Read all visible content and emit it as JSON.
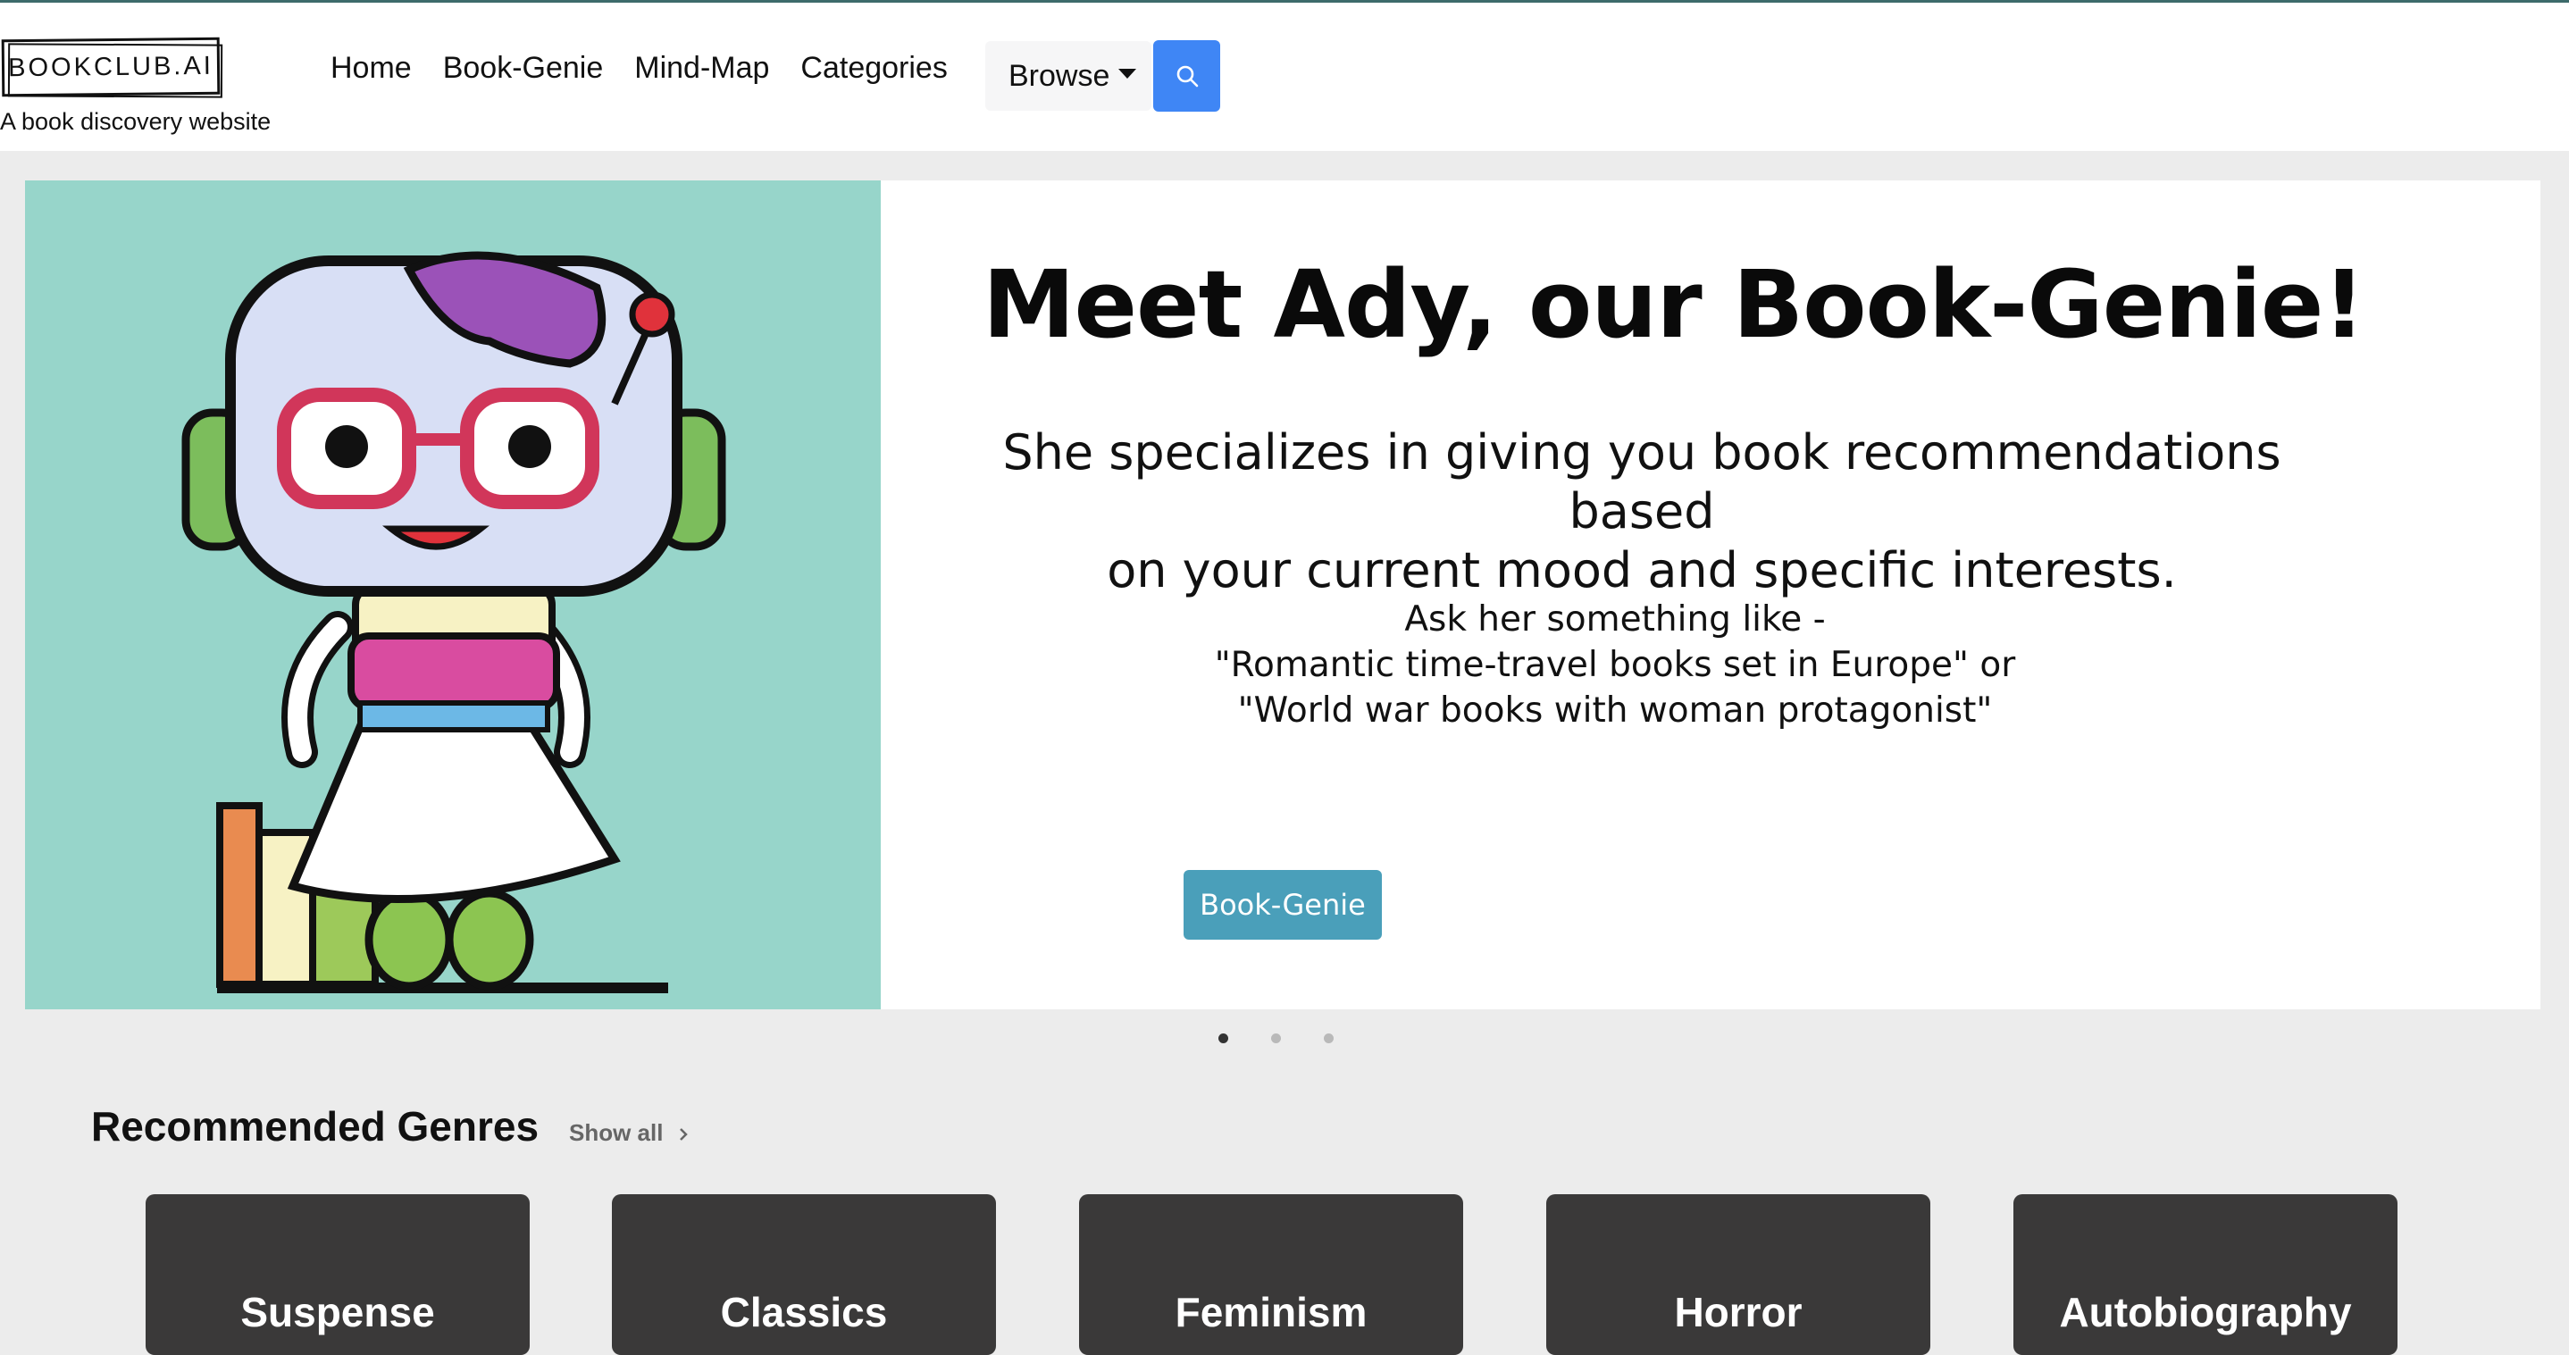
{
  "header": {
    "logo_text": "BOOKCLUB.AI",
    "tagline": "A book discovery website",
    "nav": [
      "Home",
      "Book-Genie",
      "Mind-Map",
      "Categories"
    ],
    "browse_label": "Browse"
  },
  "hero": {
    "title": "Meet Ady, our Book-Genie!",
    "desc_line1": "She specializes in giving you book recommendations based",
    "desc_line2": "on your current mood and specific interests.",
    "ask_line1": "Ask her something like -",
    "ask_line2": "\"Romantic time-travel books set in Europe\" or",
    "ask_line3": "\"World war books with woman protagonist\"",
    "button_label": "Book-Genie",
    "illustration_bg": "#97d5ca"
  },
  "carousel": {
    "slide_count": 3,
    "active_index": 0
  },
  "genres_section": {
    "title": "Recommended Genres",
    "show_all": "Show all",
    "genres": [
      "Suspense",
      "Classics",
      "Feminism",
      "Horror",
      "Autobiography"
    ]
  },
  "colors": {
    "search_button": "#3f86f5",
    "hero_button": "#4a9fba",
    "genre_card": "#3a3939"
  }
}
